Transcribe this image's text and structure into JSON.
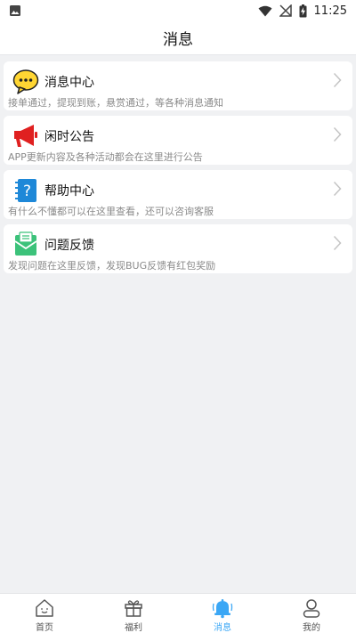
{
  "status_bar": {
    "time": "11:25"
  },
  "header": {
    "title": "消息"
  },
  "items": [
    {
      "title": "消息中心",
      "desc": "接单通过，提现到账，悬赏通过，等各种消息通知",
      "icon": "chat-bubble-icon"
    },
    {
      "title": "闲时公告",
      "desc": "APP更新内容及各种活动都会在这里进行公告",
      "icon": "megaphone-icon"
    },
    {
      "title": "帮助中心",
      "desc": "有什么不懂都可以在这里查看，还可以咨询客服",
      "icon": "help-notebook-icon"
    },
    {
      "title": "问题反馈",
      "desc": "发现问题在这里反馈，发现BUG反馈有红包奖励",
      "icon": "feedback-envelope-icon"
    }
  ],
  "tabbar": {
    "tabs": [
      {
        "label": "首页",
        "icon": "home-icon"
      },
      {
        "label": "福利",
        "icon": "gift-icon"
      },
      {
        "label": "消息",
        "icon": "bell-icon"
      },
      {
        "label": "我的",
        "icon": "profile-icon"
      }
    ],
    "active_index": 2
  },
  "colors": {
    "accent": "#3ba7f5",
    "background": "#f0f1f3"
  }
}
